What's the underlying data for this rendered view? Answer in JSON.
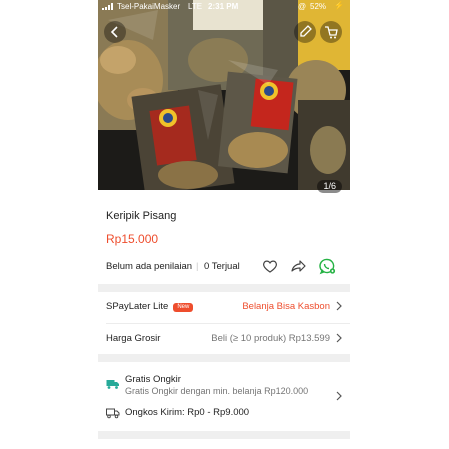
{
  "status_bar": {
    "carrier": "Tsel-PakaiMasker",
    "network": "LTE",
    "time": "2:31 PM",
    "battery": "52%"
  },
  "image_counter": "1/6",
  "product": {
    "title": "Keripik Pisang",
    "price": "Rp15.000",
    "rating_text": "Belum ada penilaian",
    "sold_text": "0 Terjual"
  },
  "icons": {
    "like": "heart-icon",
    "share": "share-icon",
    "chat": "whatsapp-icon"
  },
  "rows": {
    "spaylater_label": "SPayLater Lite",
    "spaylater_badge": "New",
    "spaylater_value": "Belanja Bisa Kasbon",
    "grosir_label": "Harga Grosir",
    "grosir_value": "Beli (≥ 10 produk) Rp13.599"
  },
  "shipping": {
    "free_title": "Gratis Ongkir",
    "free_desc": "Gratis Ongkir dengan min. belanja Rp120.000",
    "cost_label": "Ongkos Kirim: Rp0 - Rp9.000"
  },
  "colors": {
    "accent": "#ee4d2d",
    "whatsapp": "#25b244",
    "divider": "#efefef"
  }
}
